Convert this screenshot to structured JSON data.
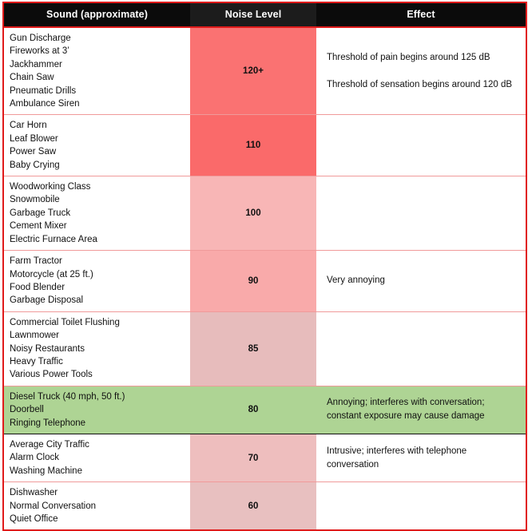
{
  "table": {
    "columns": [
      {
        "key": "sound",
        "label": "Sound (approximate)"
      },
      {
        "key": "level",
        "label": "Noise Level"
      },
      {
        "key": "effect",
        "label": "Effect"
      }
    ],
    "border_color": "#e01b1b",
    "header_background": "#000000",
    "header_text_color": "#ffffff",
    "rows": [
      {
        "sounds": [
          "Gun Discharge",
          "Fireworks at 3’",
          "Jackhammer",
          "Chain Saw",
          "Pneumatic Drills",
          "Ambulance Siren"
        ],
        "level": "120+",
        "level_color": "#fa7272",
        "effects": [
          "Threshold of pain begins around 125 dB",
          "",
          "Threshold of sensation begins around 120 dB"
        ],
        "row_color": "#ffffff",
        "separator": "none"
      },
      {
        "sounds": [
          "Car Horn",
          "Leaf Blower",
          "Power Saw",
          "Baby Crying"
        ],
        "level": "110",
        "level_color": "#fa6a6a",
        "effects": [],
        "row_color": "#ffffff",
        "separator": "dark"
      },
      {
        "sounds": [
          "Woodworking Class",
          "Snowmobile",
          "Garbage Truck",
          "Cement Mixer",
          "Electric Furnace Area"
        ],
        "level": "100",
        "level_color": "#f8b6b6",
        "effects": [],
        "row_color": "#ffffff",
        "separator": "light"
      },
      {
        "sounds": [
          "Farm Tractor",
          "Motorcycle (at 25 ft.)",
          "Food Blender",
          "Garbage Disposal"
        ],
        "level": "90",
        "level_color": "#f9aaaa",
        "effects": [
          "Very annoying"
        ],
        "row_color": "#ffffff",
        "separator": "dark"
      },
      {
        "sounds": [
          "Commercial Toilet Flushing",
          "Lawnmower",
          "Noisy Restaurants",
          "Heavy Traffic",
          "Various Power Tools"
        ],
        "level": "85",
        "level_color": "#e7bcbc",
        "effects": [],
        "row_color": "#ffffff",
        "separator": "light"
      },
      {
        "sounds": [
          "Diesel Truck (40 mph, 50 ft.)",
          "Doorbell",
          "Ringing Telephone"
        ],
        "level": "80",
        "level_color": "#aed494",
        "effects": [
          "Annoying; interferes with conversation;",
          "constant exposure may cause damage"
        ],
        "row_color": "#aed494",
        "separator": "dark"
      },
      {
        "sounds": [
          "Average City Traffic",
          "Alarm Clock",
          "Washing Machine"
        ],
        "level": "70",
        "level_color": "#eebebe",
        "effects": [
          "Intrusive; interferes with telephone",
          "conversation"
        ],
        "row_color": "#ffffff",
        "separator": "dark"
      },
      {
        "sounds": [
          "Dishwasher",
          "Normal Conversation",
          "Quiet Office"
        ],
        "level": "60",
        "level_color": "#e8c0c0",
        "effects": [],
        "row_color": "#ffffff",
        "separator": "light"
      }
    ]
  }
}
